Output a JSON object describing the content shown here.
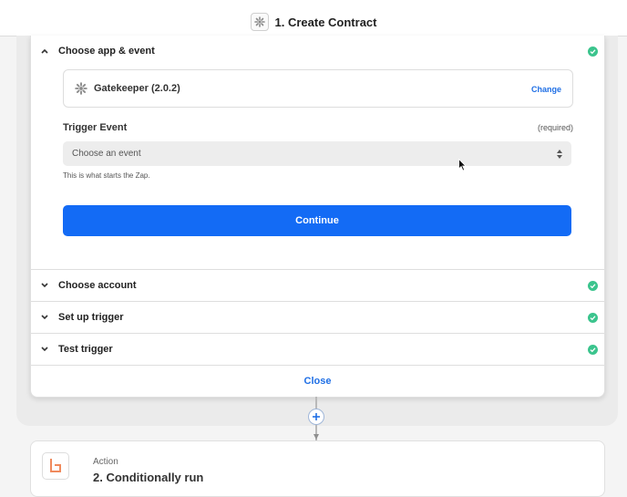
{
  "header": {
    "title": "1. Create Contract",
    "icon": "gear-icon"
  },
  "app_section": {
    "title": "Choose app & event",
    "app_name": "Gatekeeper (2.0.2)",
    "change_label": "Change",
    "trigger_label": "Trigger Event",
    "required_label": "(required)",
    "select_placeholder": "Choose an event",
    "hint": "This is what starts the Zap.",
    "continue_label": "Continue"
  },
  "sections": [
    {
      "title": "Choose account"
    },
    {
      "title": "Set up trigger"
    },
    {
      "title": "Test trigger"
    }
  ],
  "close_label": "Close",
  "next_step": {
    "kind": "Action",
    "title": "2. Conditionally run"
  },
  "colors": {
    "accent": "#136bf5",
    "link": "#1f6fe5",
    "check": "#3bc48d"
  }
}
